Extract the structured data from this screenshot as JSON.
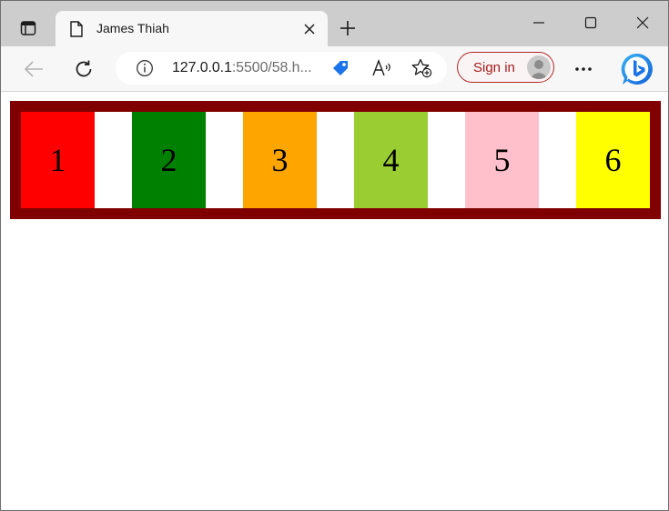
{
  "browser": {
    "tab": {
      "title": "James Thiah"
    },
    "address": {
      "host": "127.0.0.1",
      "rest": ":5500/58.h..."
    },
    "signin_label": "Sign in",
    "icons": {
      "tab_actions": "tab-actions-icon",
      "favicon": "page-icon",
      "tab_close": "close-icon",
      "new_tab": "plus-icon",
      "minimize": "minimize-icon",
      "maximize": "maximize-icon",
      "close_window": "close-icon",
      "back": "back-arrow-icon",
      "refresh": "refresh-icon",
      "site_info": "info-icon",
      "coupon": "tag-icon",
      "read_aloud": "read-aloud-icon",
      "favorites": "favorites-add-icon",
      "menu": "more-icon",
      "bing": "bing-icon"
    }
  },
  "page": {
    "boxes": [
      {
        "label": "1",
        "color": "#ff0000"
      },
      {
        "label": "2",
        "color": "#008000"
      },
      {
        "label": "3",
        "color": "#ffa500"
      },
      {
        "label": "4",
        "color": "#9acd32"
      },
      {
        "label": "5",
        "color": "#ffc0cb"
      },
      {
        "label": "6",
        "color": "#ffff00"
      }
    ],
    "container_color": "#800000"
  }
}
